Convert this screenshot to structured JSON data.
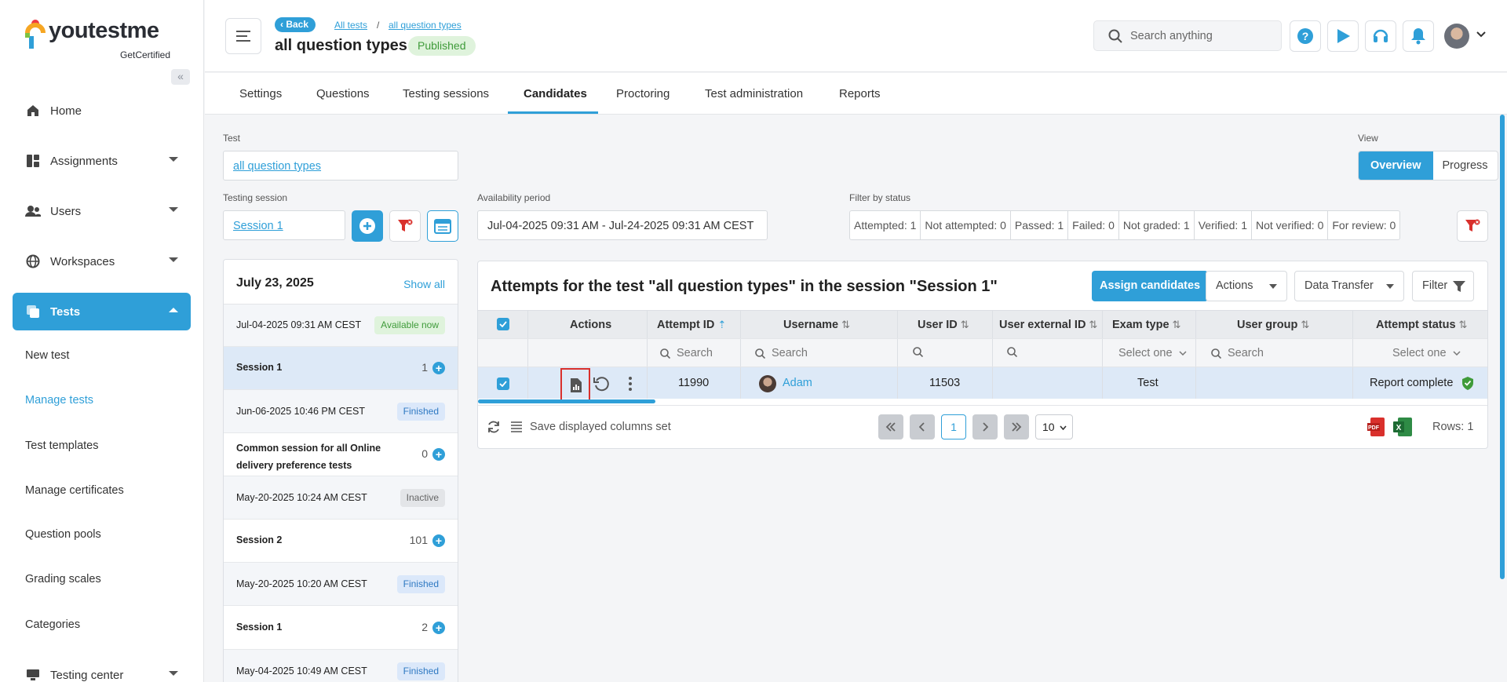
{
  "brand": {
    "name": "youtestme",
    "sub": "GetCertified"
  },
  "sidebar": {
    "items": [
      {
        "label": "Home"
      },
      {
        "label": "Assignments"
      },
      {
        "label": "Users"
      },
      {
        "label": "Workspaces"
      },
      {
        "label": "Tests"
      },
      {
        "label": "Testing center"
      }
    ],
    "sub_items": [
      "New test",
      "Manage tests",
      "Test templates",
      "Manage certificates",
      "Question pools",
      "Grading scales",
      "Categories"
    ]
  },
  "header": {
    "back_label": "Back",
    "breadcrumbs": [
      "All tests",
      "all question types"
    ],
    "title": "all question types",
    "status_badge": "Published",
    "search_placeholder": "Search anything"
  },
  "tabs": [
    "Settings",
    "Questions",
    "Testing sessions",
    "Candidates",
    "Proctoring",
    "Test administration",
    "Reports"
  ],
  "active_tab": "Candidates",
  "form": {
    "test_label": "Test",
    "test_value": "all question types",
    "session_label": "Testing session",
    "session_value": "Session 1",
    "availability_label": "Availability period",
    "availability_value": "Jul-04-2025 09:31 AM - Jul-24-2025 09:31 AM CEST",
    "filter_status_label": "Filter by status",
    "view_label": "View",
    "view_options": [
      "Overview",
      "Progress"
    ]
  },
  "status_filters": [
    "Attempted: 1",
    "Not attempted: 0",
    "Passed: 1",
    "Failed: 0",
    "Not graded: 1",
    "Verified: 1",
    "Not verified: 0",
    "For review: 0"
  ],
  "sessions_panel": {
    "date": "July 23, 2025",
    "show_all": "Show all",
    "rows": [
      {
        "date": "Jul-04-2025 09:31 AM CEST",
        "badge": "Available now",
        "name": "Session 1",
        "count": "1"
      },
      {
        "date": "Jun-06-2025 10:46 PM CEST",
        "badge": "Finished",
        "name": "Common session for all Online delivery preference tests",
        "count": "0"
      },
      {
        "date": "May-20-2025 10:24 AM CEST",
        "badge": "Inactive",
        "name": "Session 2",
        "count": "101"
      },
      {
        "date": "May-20-2025 10:20 AM CEST",
        "badge": "Finished",
        "name": "Session 1",
        "count": "2"
      },
      {
        "date": "May-04-2025 10:49 AM CEST",
        "badge": "Finished"
      }
    ]
  },
  "attempts": {
    "title": "Attempts for the test \"all question types\" in the session \"Session 1\"",
    "assign_button": "Assign candidates",
    "actions_button": "Actions",
    "data_transfer_button": "Data Transfer",
    "filter_button": "Filter",
    "columns": [
      "Actions",
      "Attempt ID",
      "Username",
      "User ID",
      "User external ID",
      "Exam type",
      "User group",
      "Attempt status"
    ],
    "filters": {
      "search": "Search",
      "select": "Select one"
    },
    "row": {
      "attempt_id": "11990",
      "username": "Adam",
      "user_id": "11503",
      "user_external_id": "",
      "exam_type": "Test",
      "user_group": "",
      "attempt_status": "Report complete"
    },
    "footer": {
      "save_columns": "Save displayed columns set",
      "page": "1",
      "page_size": "10",
      "rows": "Rows: 1"
    }
  },
  "colors": {
    "accent": "#2f9fd8",
    "success": "#3f9b3a",
    "highlight": "#d9302c"
  }
}
